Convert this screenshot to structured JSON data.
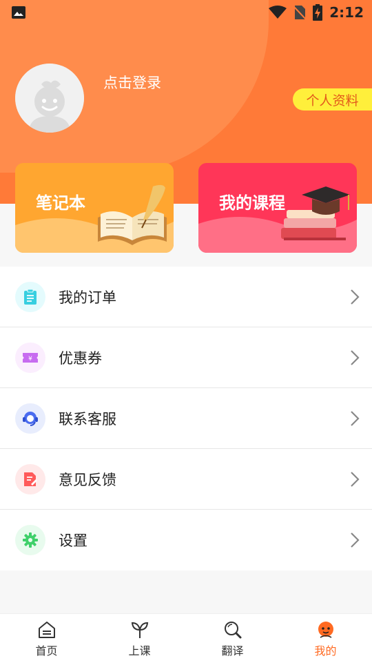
{
  "status_bar": {
    "time": "2:12"
  },
  "header": {
    "login_text": "点击登录",
    "profile_button": "个人资料"
  },
  "cards": [
    {
      "title": "笔记本"
    },
    {
      "title": "我的课程"
    }
  ],
  "menu": [
    {
      "label": "我的订单",
      "icon": "clipboard-icon",
      "color": "#38cfe0"
    },
    {
      "label": "优惠券",
      "icon": "coupon-icon",
      "color": "#c76bf0"
    },
    {
      "label": "联系客服",
      "icon": "headset-icon",
      "color": "#4a6cf0"
    },
    {
      "label": "意见反馈",
      "icon": "feedback-icon",
      "color": "#ff5a5a"
    },
    {
      "label": "设置",
      "icon": "gear-icon",
      "color": "#3fd06a"
    }
  ],
  "tabs": [
    {
      "label": "首页",
      "icon": "home-icon",
      "active": false
    },
    {
      "label": "上课",
      "icon": "sprout-icon",
      "active": false
    },
    {
      "label": "翻译",
      "icon": "search-icon",
      "active": false
    },
    {
      "label": "我的",
      "icon": "profile-face-icon",
      "active": true
    }
  ],
  "colors": {
    "accent": "#ff7a38",
    "active_tab": "#ff6a22",
    "profile_button_bg": "#ffef3b"
  }
}
